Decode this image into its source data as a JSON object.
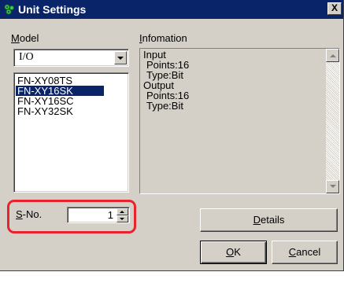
{
  "window": {
    "title": "Unit Settings",
    "close_glyph": "X",
    "icon": "gear-cluster-icon"
  },
  "model": {
    "label_mnemonic": "M",
    "label_rest": "odel",
    "selected": "I/O",
    "items": [
      "FN-XY08TS",
      "FN-XY16SK",
      "FN-XY16SC",
      "FN-XY32SK"
    ],
    "selected_index": 1
  },
  "information": {
    "label_mnemonic": "I",
    "label_rest": "nfomation",
    "lines": [
      "Input",
      " Points:16",
      " Type:Bit",
      "Output",
      " Points:16",
      " Type:Bit"
    ]
  },
  "sno": {
    "label_mnemonic": "S",
    "label_rest": "-No.",
    "value": "1"
  },
  "buttons": {
    "details_mnemonic": "D",
    "details_rest": "etails",
    "ok_mnemonic": "O",
    "ok_rest": "K",
    "cancel_mnemonic": "C",
    "cancel_rest": "ancel"
  },
  "colors": {
    "highlight": "#e8232d",
    "selection": "#0a246a",
    "face": "#d4d0c8"
  }
}
